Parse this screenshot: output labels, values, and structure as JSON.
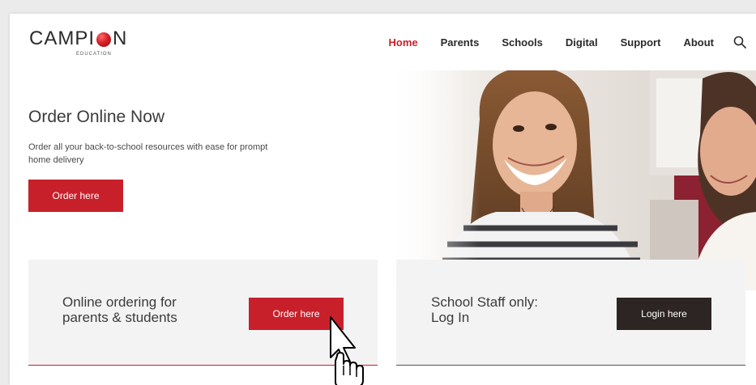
{
  "brand": {
    "logo_left": "CAMPI",
    "logo_right": "N",
    "logo_sub": "EDUCATION",
    "accent_color": "#c8202b"
  },
  "nav": {
    "items": [
      {
        "label": "Home",
        "active": true
      },
      {
        "label": "Parents"
      },
      {
        "label": "Schools"
      },
      {
        "label": "Digital"
      },
      {
        "label": "Support"
      },
      {
        "label": "About"
      }
    ],
    "search_icon": "search-icon"
  },
  "hero": {
    "title": "Order Online Now",
    "description": "Order all your back-to-school resources with ease for prompt home delivery",
    "button_label": "Order here"
  },
  "cards": {
    "parents": {
      "text_line1": "Online ordering for",
      "text_line2": "parents & students",
      "button_label": "Order here"
    },
    "staff": {
      "text_line1": "School Staff only:",
      "text_line2": "Log In",
      "button_label": "Login here"
    }
  }
}
